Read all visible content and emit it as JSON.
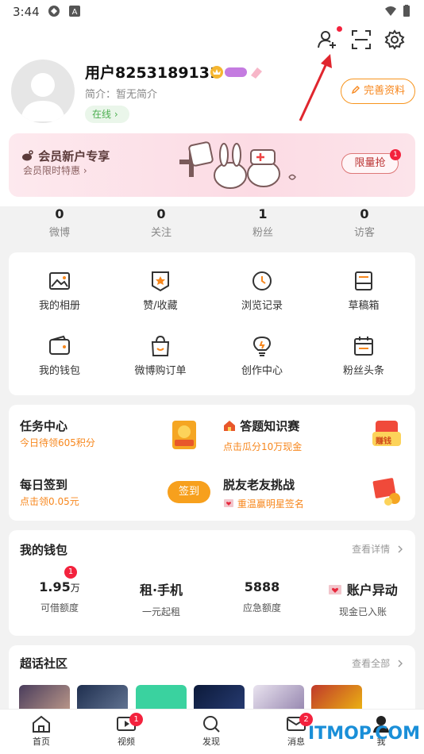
{
  "status_bar": {
    "time": "3:44"
  },
  "profile": {
    "username": "用户8253189131",
    "bio": "简介：暂无简介",
    "online": "在线 ›",
    "edit_button": "完善资料"
  },
  "vip_banner": {
    "title": "会员新户专享",
    "subtitle": "会员限时特惠 ›",
    "button": "限量抢",
    "badge": "1"
  },
  "stats": [
    {
      "value": "0",
      "label": "微博"
    },
    {
      "value": "0",
      "label": "关注"
    },
    {
      "value": "1",
      "label": "粉丝"
    },
    {
      "value": "0",
      "label": "访客"
    }
  ],
  "grid": [
    {
      "label": "我的相册",
      "icon": "photo-album-icon"
    },
    {
      "label": "赞/收藏",
      "icon": "like-collect-icon"
    },
    {
      "label": "浏览记录",
      "icon": "history-icon"
    },
    {
      "label": "草稿箱",
      "icon": "drafts-icon"
    },
    {
      "label": "我的钱包",
      "icon": "wallet-icon"
    },
    {
      "label": "微博购订单",
      "icon": "shopping-bag-icon"
    },
    {
      "label": "创作中心",
      "icon": "bulb-icon"
    },
    {
      "label": "粉丝头条",
      "icon": "headline-icon"
    }
  ],
  "tasks": {
    "task_center": {
      "title": "任务中心",
      "sub": "今日待领605积分"
    },
    "quiz": {
      "title": "答题知识赛",
      "sub": "点击瓜分10万现金",
      "badge": "赚钱"
    },
    "checkin": {
      "title": "每日签到",
      "sub": "点击领0.05元",
      "button": "签到"
    },
    "challenge": {
      "title": "脱友老友挑战",
      "sub": "重温赢明星签名"
    }
  },
  "wallet": {
    "title": "我的钱包",
    "link": "查看详情",
    "badge": "1",
    "cols": [
      {
        "big": "1.95",
        "unit": "万",
        "small": "可借额度"
      },
      {
        "big": "租·手机",
        "unit": "",
        "small": "一元起租"
      },
      {
        "big": "5888",
        "unit": "",
        "small": "应急额度"
      },
      {
        "big": "账户异动",
        "unit": "",
        "small": "现金已入账"
      }
    ]
  },
  "super_topic": {
    "title": "超话社区",
    "link": "查看全部"
  },
  "nav": [
    {
      "label": "首页",
      "icon": "home-icon"
    },
    {
      "label": "视频",
      "icon": "video-icon",
      "badge": "1"
    },
    {
      "label": "发现",
      "icon": "discover-icon"
    },
    {
      "label": "消息",
      "icon": "message-icon",
      "badge": "2"
    },
    {
      "label": "我",
      "icon": "me-icon"
    }
  ],
  "watermark": "ITMOP.COM",
  "colors": {
    "accent": "#f7871d",
    "badge": "#f3223d",
    "online": "#4caf50"
  }
}
